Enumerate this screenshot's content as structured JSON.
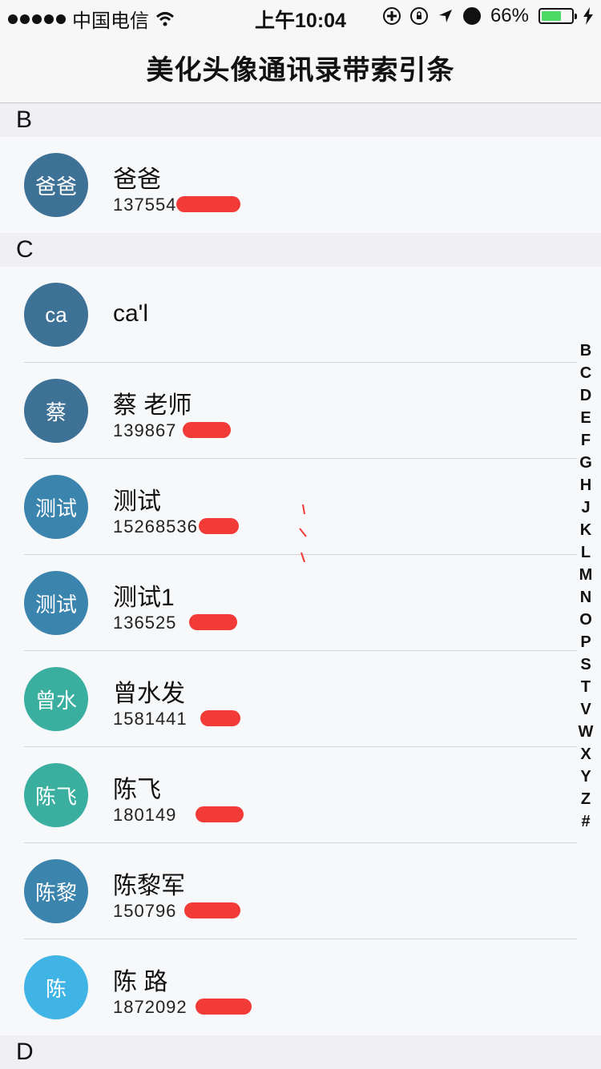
{
  "status_bar": {
    "carrier": "中国电信",
    "time": "上午10:04",
    "battery_percent": "66%",
    "battery_level": 0.66,
    "icons": [
      "signal-dots",
      "wifi-icon",
      "plus-circle-icon",
      "rotation-lock-icon",
      "location-arrow-icon",
      "alarm-icon",
      "battery-icon",
      "charging-bolt-icon"
    ]
  },
  "nav": {
    "title": "美化头像通讯录带索引条"
  },
  "sections": [
    {
      "letter": "B",
      "contacts": [
        {
          "avatar": "爸爸",
          "name": "爸爸",
          "phone": "137554",
          "avatar_color": "#3d7196"
        }
      ]
    },
    {
      "letter": "C",
      "contacts": [
        {
          "avatar": "ca",
          "name": "ca'l",
          "phone": "",
          "avatar_color": "#3d7196"
        },
        {
          "avatar": "蔡",
          "name": "蔡 老师",
          "phone": "139867",
          "avatar_color": "#3d7196"
        },
        {
          "avatar": "测试",
          "name": "测试",
          "phone": "15268536",
          "avatar_color": "#3a84ae"
        },
        {
          "avatar": "测试",
          "name": "测试1",
          "phone": "136525",
          "avatar_color": "#3a84ae"
        },
        {
          "avatar": "曾水",
          "name": "曾水发",
          "phone": "1581441",
          "avatar_color": "#3aafa0"
        },
        {
          "avatar": "陈飞",
          "name": "陈飞",
          "phone": "180149",
          "avatar_color": "#3aafa0"
        },
        {
          "avatar": "陈黎",
          "name": "陈黎军",
          "phone": "150796",
          "avatar_color": "#3a84ae"
        },
        {
          "avatar": "陈",
          "name": "陈 路",
          "phone": "1872092",
          "avatar_color": "#41b4e6"
        }
      ]
    },
    {
      "letter": "D",
      "contacts": []
    }
  ],
  "index_letters": [
    "B",
    "C",
    "D",
    "E",
    "F",
    "G",
    "H",
    "J",
    "K",
    "L",
    "M",
    "N",
    "O",
    "P",
    "S",
    "T",
    "V",
    "W",
    "X",
    "Y",
    "Z",
    "#"
  ],
  "colors": {
    "redaction": "#f23a36",
    "section_bg": "#efeff4"
  }
}
